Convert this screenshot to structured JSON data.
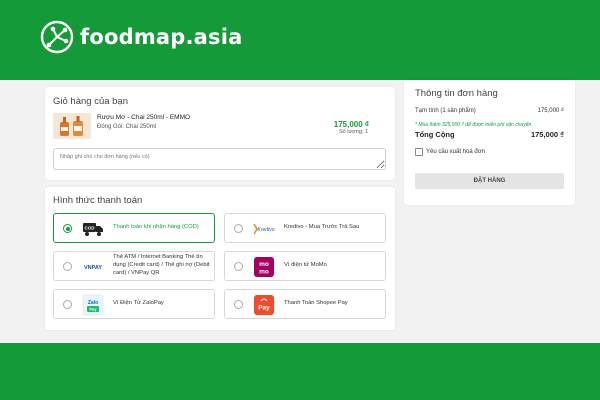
{
  "brand": {
    "name": "foodmap.asia",
    "color": "#159a3a"
  },
  "cart": {
    "title": "Giỏ hàng của bạn",
    "product": {
      "name": "Rượu Mơ - Chai 250ml - EMMO",
      "variant": "Đóng Gói: Chai 250ml",
      "price": "175,000 ₫",
      "quantity": "Số lượng: 1"
    },
    "note_placeholder": "Nhập ghi chú cho đơn hàng (nếu có)"
  },
  "payment": {
    "title": "Hình thức thanh toán",
    "options": [
      {
        "label": "Thanh toán khi nhận hàng (COD)",
        "icon": "cod-truck-icon",
        "selected": true
      },
      {
        "label": "Kredivo - Mua Trước Trả Sau",
        "icon": "kredivo-logo",
        "selected": false
      },
      {
        "label": "Thẻ ATM / Internet Banking Thẻ tín dụng (Credit card) / Thẻ ghi nợ (Debit card) / VNPay QR",
        "icon": "vnpay-logo",
        "selected": false
      },
      {
        "label": "Ví điện tử MoMo",
        "icon": "momo-logo",
        "selected": false
      },
      {
        "label": "Ví Điện Tử ZaloPay",
        "icon": "zalopay-logo",
        "selected": false
      },
      {
        "label": "Thanh Toán Shopee Pay",
        "icon": "shopeepay-logo",
        "selected": false
      }
    ],
    "logo_text": {
      "cod": "COD",
      "kredivo": "Kredivo",
      "vnpay": "VNPAY",
      "momo_top": "mo",
      "momo_bottom": "mo",
      "zalo_top": "Zalo",
      "zalo_bottom": "Pay",
      "shopee": "Pay"
    }
  },
  "summary": {
    "title": "Thông tin đơn hàng",
    "subtotal_label": "Tạm tính (1 sản phẩm)",
    "subtotal_value": "175,000 ₫",
    "shipping_note": "* Mua thêm 325,000 ₫ để được miễn phí vận chuyển",
    "total_label": "Tổng Cộng",
    "total_value": "175,000 ₫",
    "invoice_label": "Yêu cầu xuất hoá đơn",
    "order_button": "ĐẶT HÀNG"
  }
}
